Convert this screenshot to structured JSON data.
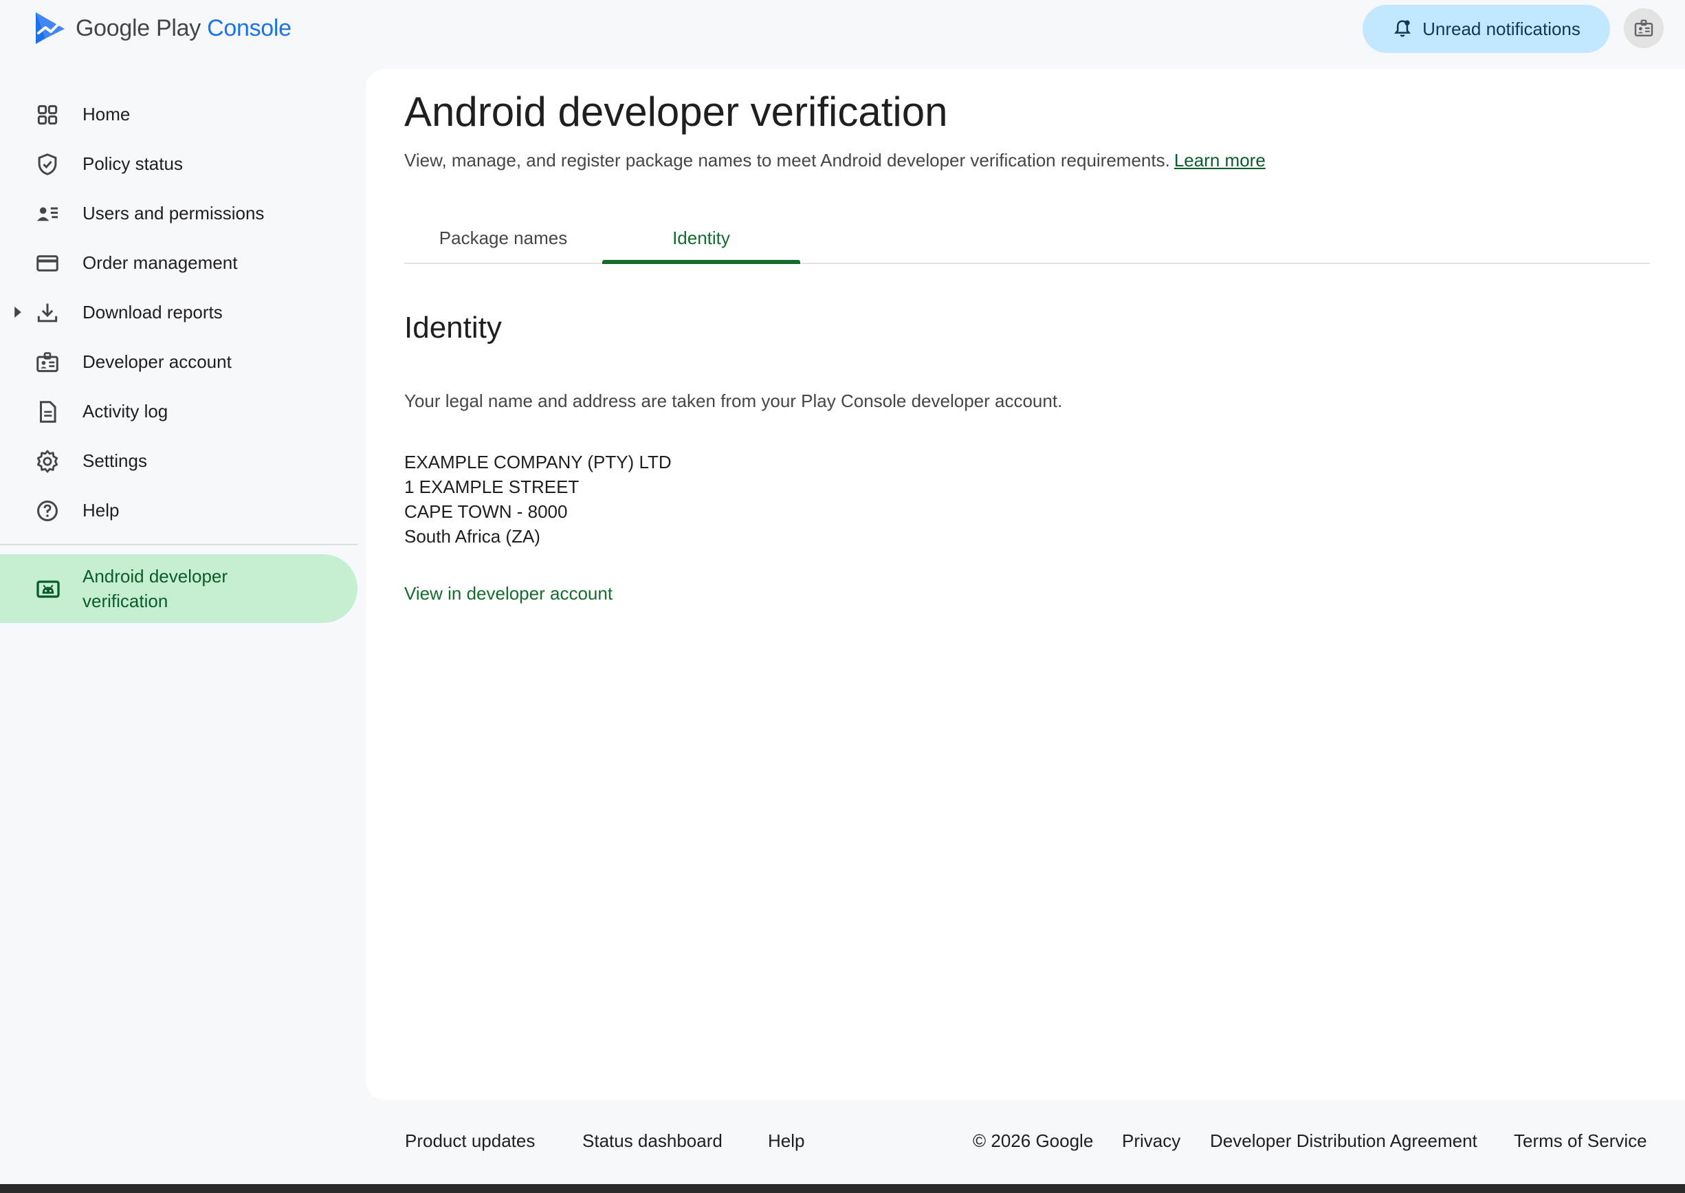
{
  "app": {
    "logo_text_google": "Google Play",
    "logo_text_console": "Console",
    "notifications_label": "Unread notifications"
  },
  "sidebar": {
    "items": [
      {
        "label": "Home",
        "icon": "home-grid-icon"
      },
      {
        "label": "Policy status",
        "icon": "shield-check-icon"
      },
      {
        "label": "Users and permissions",
        "icon": "users-list-icon"
      },
      {
        "label": "Order management",
        "icon": "credit-card-icon"
      },
      {
        "label": "Download reports",
        "icon": "download-icon"
      },
      {
        "label": "Developer account",
        "icon": "id-badge-icon"
      },
      {
        "label": "Activity log",
        "icon": "document-icon"
      },
      {
        "label": "Settings",
        "icon": "gear-icon"
      },
      {
        "label": "Help",
        "icon": "help-circle-icon"
      }
    ],
    "active": {
      "label": "Android developer verification",
      "icon": "android-icon"
    }
  },
  "main": {
    "title": "Android developer verification",
    "subtitle": "View, manage, and register package names to meet Android developer verification requirements.",
    "learn_more": "Learn more",
    "tabs": [
      {
        "label": "Package names",
        "selected": false
      },
      {
        "label": "Identity",
        "selected": true
      }
    ],
    "section_title": "Identity",
    "description": "Your legal name and address are taken from your Play Console developer account.",
    "address": [
      "EXAMPLE COMPANY (PTY) LTD",
      "1 EXAMPLE STREET",
      "CAPE TOWN - 8000",
      "South Africa (ZA)"
    ],
    "view_link": "View in developer account"
  },
  "footer": {
    "left": [
      "Product updates",
      "Status dashboard",
      "Help"
    ],
    "copyright": "© 2026 Google",
    "right": [
      "Privacy",
      "Developer Distribution Agreement",
      "Terms of Service"
    ]
  },
  "colors": {
    "accent_green": "#146c2e",
    "active_nav_bg": "#c6efd2",
    "notification_bg": "#c2e7ff",
    "brand_blue": "#1a73e8"
  }
}
